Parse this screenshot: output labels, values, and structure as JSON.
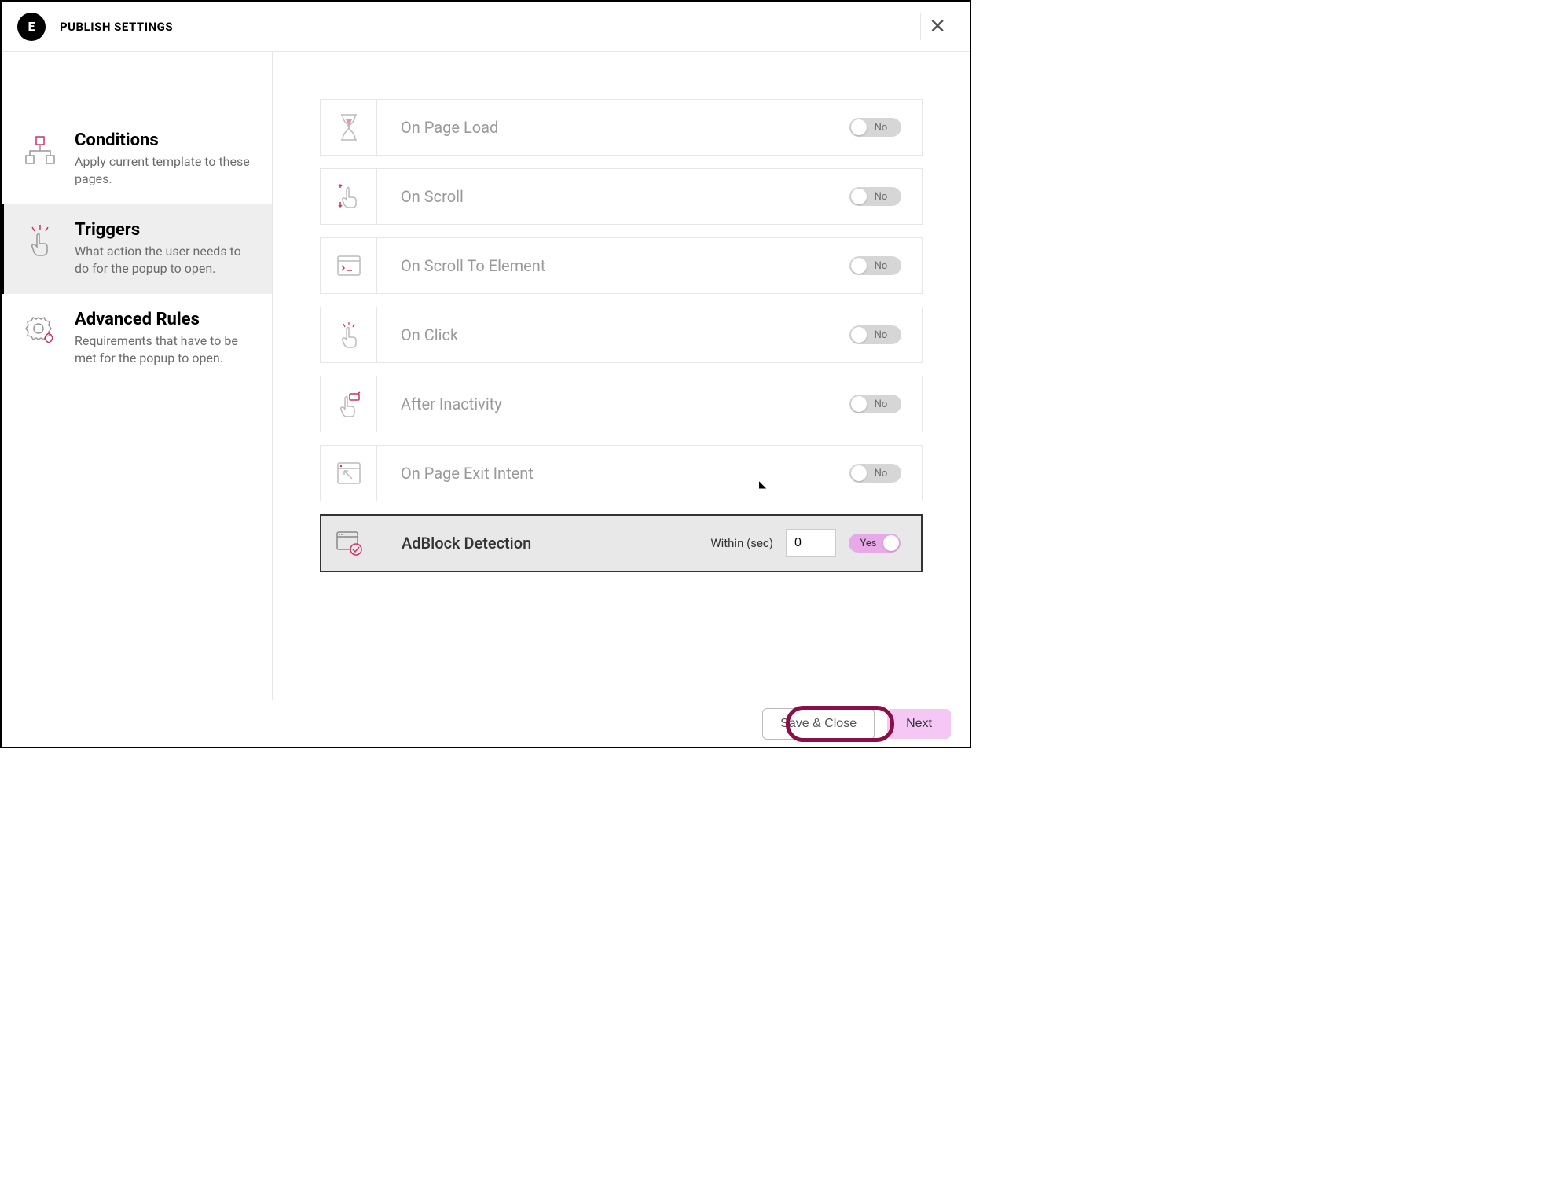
{
  "header": {
    "title": "PUBLISH SETTINGS",
    "logo_text": "E"
  },
  "sidebar": {
    "conditions": {
      "title": "Conditions",
      "desc": "Apply current template to these pages."
    },
    "triggers": {
      "title": "Triggers",
      "desc": "What action the user needs to do for the popup to open."
    },
    "advanced": {
      "title": "Advanced Rules",
      "desc": "Requirements that have to be met for the popup to open."
    }
  },
  "triggers": [
    {
      "label": "On Page Load",
      "state": "No"
    },
    {
      "label": "On Scroll",
      "state": "No"
    },
    {
      "label": "On Scroll To Element",
      "state": "No"
    },
    {
      "label": "On Click",
      "state": "No"
    },
    {
      "label": "After Inactivity",
      "state": "No"
    },
    {
      "label": "On Page Exit Intent",
      "state": "No"
    }
  ],
  "adblock": {
    "label": "AdBlock Detection",
    "within_label": "Within (sec)",
    "within_value": "0",
    "state": "Yes"
  },
  "footer": {
    "save": "Save & Close",
    "next": "Next"
  }
}
